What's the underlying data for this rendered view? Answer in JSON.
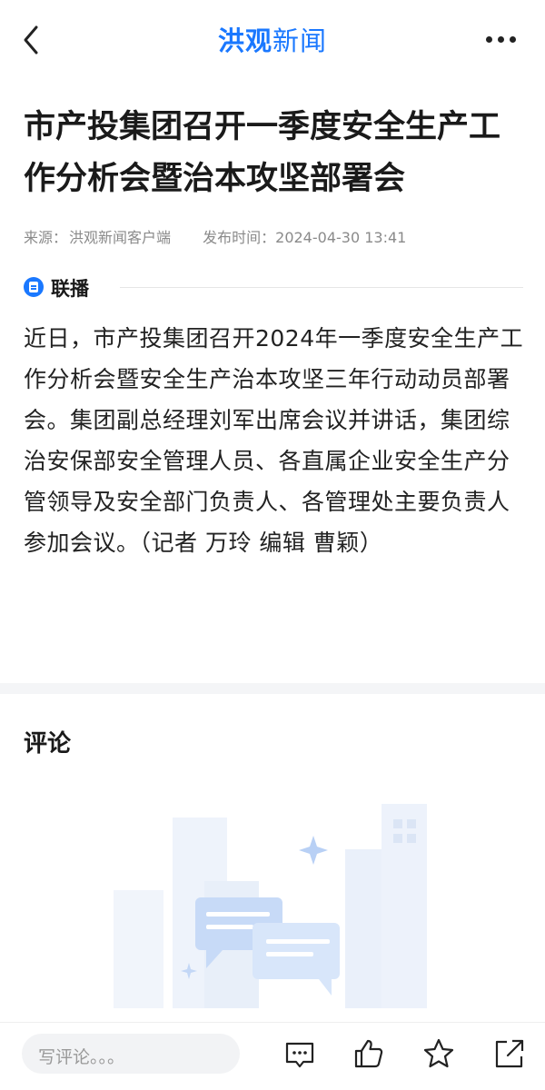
{
  "header": {
    "logo_part1": "洪观",
    "logo_part2": "新闻",
    "back_icon": "chevron-left-icon",
    "more_icon": "more-dots-icon"
  },
  "article": {
    "title": "市产投集团召开一季度安全生产工作分析会暨治本攻坚部署会",
    "source_label": "来源：",
    "source_value": "洪观新闻客户端",
    "publish_label": "发布时间：",
    "publish_value": "2024-04-30 13:41",
    "channel_name": "联播",
    "body": "近日，市产投集团召开2024年一季度安全生产工作分析会暨安全生产治本攻坚三年行动动员部署会。集团副总经理刘军出席会议并讲话，集团综治安保部安全管理人员、各直属企业安全生产分管领导及安全部门负责人、各管理处主要负责人参加会议。（记者 万玲 编辑 曹颖）"
  },
  "comments": {
    "title": "评论"
  },
  "bottom_bar": {
    "input_placeholder": "写评论。。。",
    "icons": [
      "comment-icon",
      "like-icon",
      "favorite-star-icon",
      "share-icon"
    ]
  },
  "colors": {
    "brand": "#1a78ff",
    "text": "#222222",
    "meta": "#8a8a8a"
  }
}
